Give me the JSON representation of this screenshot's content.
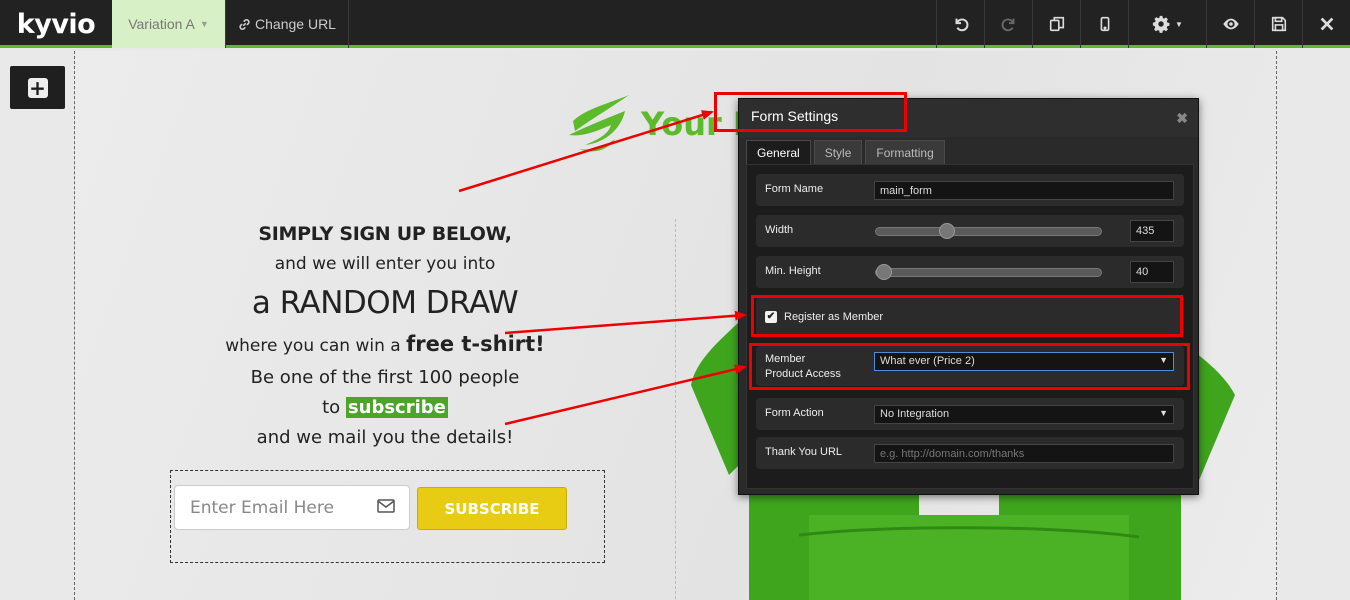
{
  "app": {
    "logo_text": "kyvio",
    "variation_label": "Variation A",
    "change_url_label": "Change URL"
  },
  "toolbar": {
    "icons": [
      "undo-icon",
      "redo-icon",
      "copy-icon",
      "mobile-icon",
      "gear-icon",
      "eye-icon",
      "save-icon",
      "close-icon"
    ]
  },
  "page": {
    "logo_text": "Your L",
    "headline": {
      "line1": "SIMPLY SIGN UP BELOW,",
      "line2": "and we will enter you into",
      "line3": "a RANDOM DRAW",
      "line4_prefix": "where you can win a ",
      "line4_bold": "free t-shirt!",
      "line5": "Be one of the first 100 people",
      "line6_prefix": "to ",
      "line6_highlight": "subscribe",
      "line7": "and we mail you the details!"
    },
    "email_placeholder": "Enter Email Here",
    "subscribe_label": "SUBSCRIBE"
  },
  "dialog": {
    "title": "Form Settings",
    "tabs": [
      {
        "label": "General",
        "active": true
      },
      {
        "label": "Style",
        "active": false
      },
      {
        "label": "Formatting",
        "active": false
      }
    ],
    "form_name_label": "Form Name",
    "form_name_value": "main_form",
    "width_label": "Width",
    "width_value": "435",
    "width_slider_fraction": 0.3,
    "min_height_label": "Min. Height",
    "min_height_value": "40",
    "min_height_slider_fraction": 0.0,
    "register_label": "Register as Member",
    "register_checked": true,
    "member_access_label_1": "Member",
    "member_access_label_2": "Product Access",
    "member_access_value": "What ever (Price 2)",
    "form_action_label": "Form Action",
    "form_action_value": "No Integration",
    "thank_you_label": "Thank You URL",
    "thank_you_placeholder": "e.g. http://domain.com/thanks"
  },
  "colors": {
    "accent_green": "#5dbb2b",
    "subscribe_yellow": "#e8cc13",
    "annotation_red": "#e00000"
  }
}
